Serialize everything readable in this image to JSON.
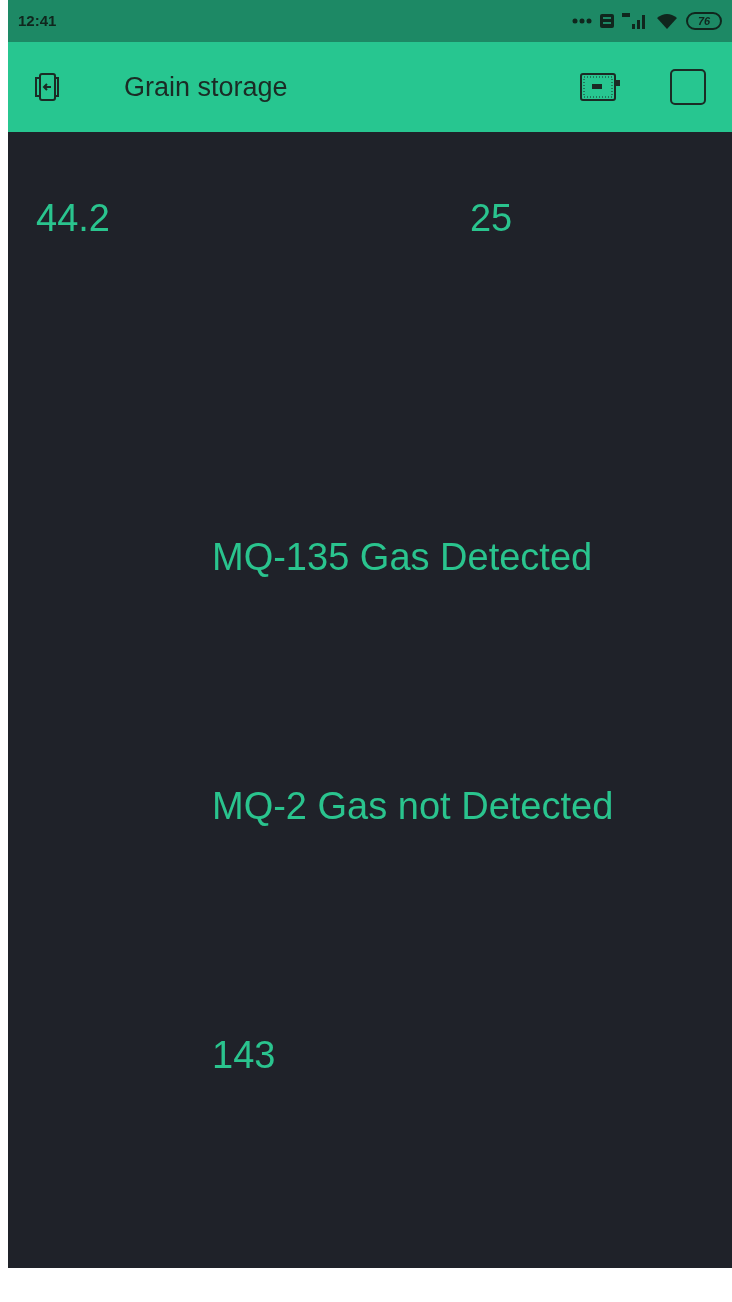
{
  "status_bar": {
    "time": "12:41",
    "battery": "76"
  },
  "header": {
    "title": "Grain storage"
  },
  "top_values": [
    {
      "text": "44.2"
    },
    {
      "text": "25"
    }
  ],
  "labels": [
    {
      "text": "MQ-135 Gas Detected"
    },
    {
      "text": "MQ-2 Gas not Detected"
    },
    {
      "text": "143"
    }
  ]
}
